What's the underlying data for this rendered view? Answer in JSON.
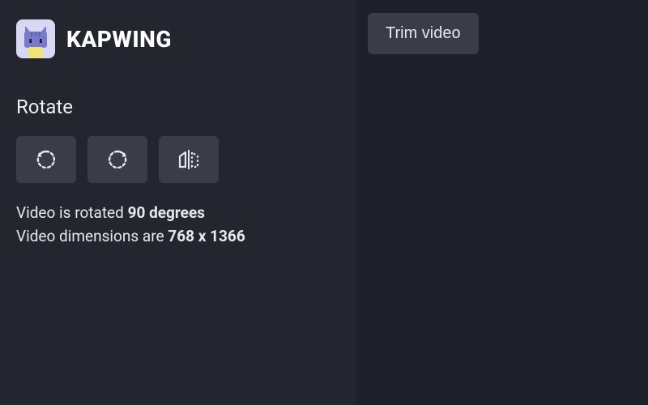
{
  "brand": {
    "name": "KAPWING",
    "logo_icon": "cat-mascot"
  },
  "section": {
    "title": "Rotate"
  },
  "buttons": {
    "rotate_ccw_icon": "rotate-ccw-icon",
    "rotate_cw_icon": "rotate-cw-icon",
    "flip_icon": "flip-horizontal-icon"
  },
  "status": {
    "rotation_prefix": "Video is rotated ",
    "rotation_value": "90 degrees",
    "dimensions_prefix": "Video dimensions are ",
    "dimensions_value": "768 x 1366"
  },
  "right": {
    "trim_label": "Trim video"
  }
}
